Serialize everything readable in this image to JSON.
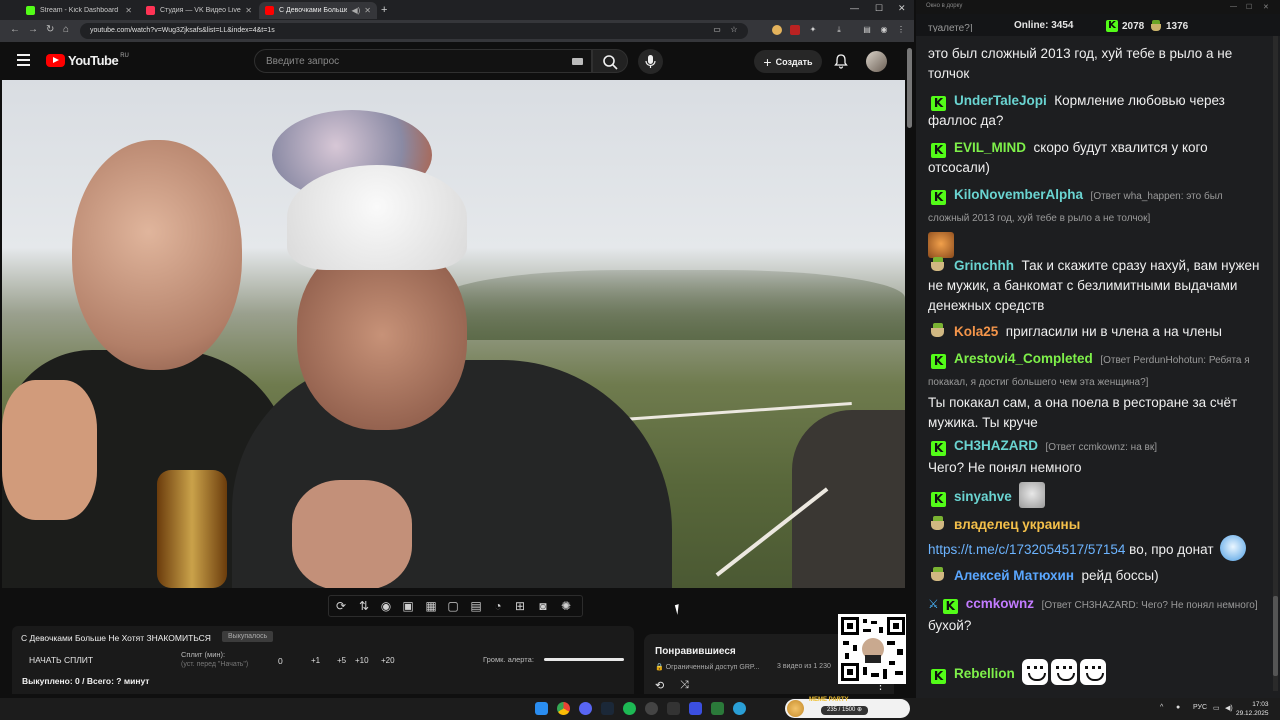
{
  "browser": {
    "tabs": [
      {
        "label": "Stream - Kick Dashboard",
        "favicon_color": "#53fc18"
      },
      {
        "label": "Студия — VK Видео Live",
        "favicon_color": "#ff3355"
      },
      {
        "label": "С Девочками Больше Не",
        "favicon_color": "#ff0000"
      }
    ],
    "new_tab": "+",
    "url": "youtube.com/watch?v=Wug3Zjksafs&list=LL&index=4&t=1s"
  },
  "youtube": {
    "logo_text": "YouTube",
    "logo_region": "RU",
    "search_placeholder": "Введите запрос",
    "create_label": "Создать"
  },
  "panel": {
    "title": "С Девочками Больше Не Хотят ЗНАКОМИТЬСЯ",
    "badge": "Выкупалось",
    "start_label": "НАЧАТЬ СПЛИТ",
    "split_label": "Сплит (мин):",
    "split_sub": "(уст. перед \"Начать\")",
    "split_value": "0",
    "steps": [
      "+1",
      "+5",
      "+10",
      "+20"
    ],
    "alert_label": "Громк. алерта:",
    "alert_volume": 1.0,
    "result": "Выкуплено: 0 / Всего: ? минут"
  },
  "liked": {
    "title": "Понравившиеся",
    "access": "Ограниченный доступ GRP...",
    "count": "3 видео из 1 230"
  },
  "chat": {
    "window_title": "Окно в дорку",
    "online_label": "Online:",
    "online_value": "3454",
    "kick_count": "2078",
    "vk_count": "1376",
    "messages": [
      {
        "text": "это был сложный 2013 год, хуй тебе в рыло а не толчок"
      },
      {
        "badge": "kick",
        "nick": "UnderTaleJopi",
        "color": "#6ad4d1",
        "text": "Кормление любовью через фаллос да?"
      },
      {
        "badge": "kick",
        "nick": "EVIL_MIND",
        "color": "#7ef04a",
        "text": "скоро будут хвалится у кого отсосали)"
      },
      {
        "badge": "kick",
        "nick": "KiloNovemberAlpha",
        "color": "#6ad4d1",
        "reply": "[Ответ wha_happen: это был сложный 2013 год, хуй тебе в рыло а не толчок]"
      },
      {
        "badge": "vk",
        "nick": "Grinchhh",
        "color": "#6ad4d1",
        "text": "Так и скажите сразу нахуй, вам нужен не мужик, а банкомат с безлимитными выдачами денежных средств"
      },
      {
        "badge": "vk",
        "nick": "Kola25",
        "color": "#f4954a",
        "text": "пригласили ни в члена а на члены"
      },
      {
        "badge": "kick",
        "nick": "Arestovi4_Completed",
        "color": "#7ef04a",
        "reply": "[Ответ PerdunHohotun: Ребята я покакал, я достиг большего чем эта женщина?]",
        "text": "Ты покакал сам, а она поела в ресторане за счёт мужика. Ты круче"
      },
      {
        "badge": "kick",
        "nick": "CH3HAZARD",
        "color": "#6ad4d1",
        "reply": "[Ответ ccmkownz: на вк]",
        "text": "Чего? Не понял немного"
      },
      {
        "badge": "kick",
        "nick": "sinyahve",
        "color": "#6ad4d1"
      },
      {
        "badge": "vk",
        "nick": "владелец украины",
        "color": "#f4c04a",
        "link": "https://t.me/c/1732054517/57154",
        "text": "во, про донат"
      },
      {
        "badge": "vk",
        "nick": "Алексей Матюхин",
        "color": "#5aa7ff",
        "text": "рейд боссы)"
      },
      {
        "badge": "kick",
        "nick": "ccmkownz",
        "color": "#c27bff",
        "reply": "[Ответ CH3HAZARD: Чего? Не понял немного]",
        "text": "бухой?"
      },
      {
        "badge": "kick",
        "nick": "Rebellion",
        "color": "#7ef04a"
      }
    ]
  },
  "meme_party": {
    "title": "MEME PARTY",
    "counter": "235 / 1500 ⊕"
  },
  "taskbar": {
    "lang": "РУС",
    "time": "17:03",
    "date": "29.12.2025"
  }
}
